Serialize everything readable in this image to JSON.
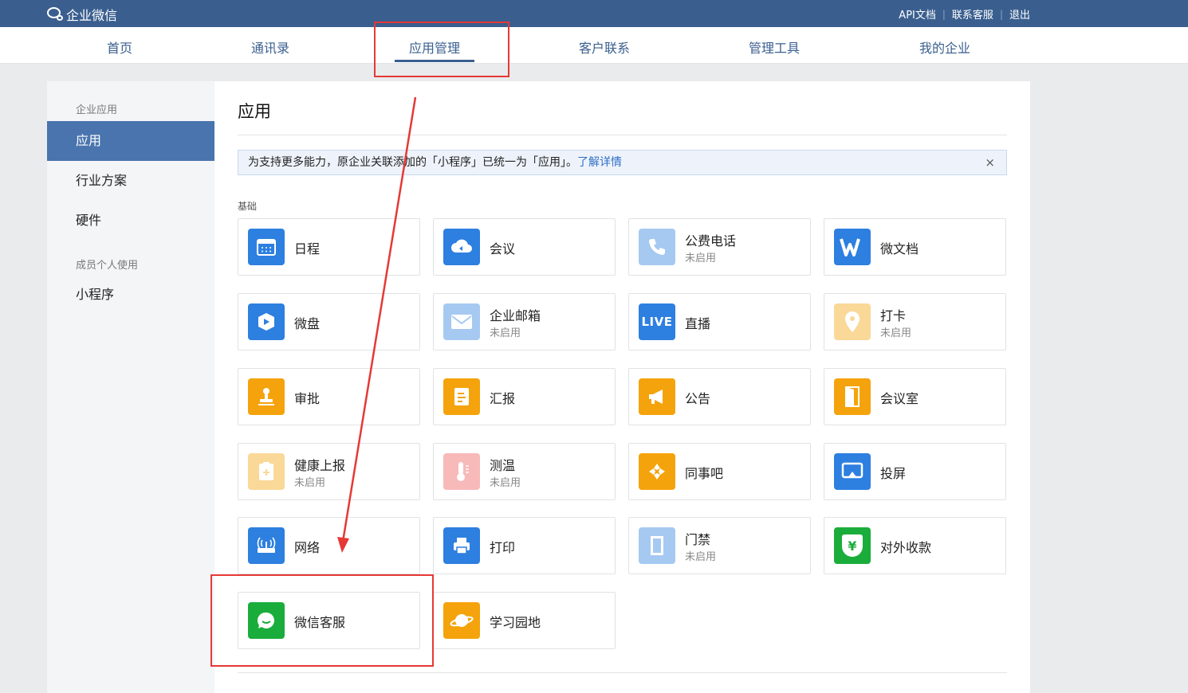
{
  "brand": {
    "name": "企业微信"
  },
  "top_links": [
    "API文档",
    "联系客服",
    "退出"
  ],
  "nav": {
    "items": [
      {
        "label": "首页"
      },
      {
        "label": "通讯录"
      },
      {
        "label": "应用管理",
        "active": true
      },
      {
        "label": "客户联系"
      },
      {
        "label": "管理工具"
      },
      {
        "label": "我的企业"
      }
    ]
  },
  "sidebar": {
    "groups": [
      {
        "title": "企业应用",
        "items": [
          {
            "label": "应用",
            "active": true
          },
          {
            "label": "行业方案"
          },
          {
            "label": "硬件"
          }
        ]
      },
      {
        "title": "成员个人使用",
        "items": [
          {
            "label": "小程序"
          }
        ]
      }
    ]
  },
  "main": {
    "title": "应用",
    "notice": {
      "text": "为支持更多能力，原企业关联添加的「小程序」已统一为「应用」。",
      "link": "了解详情",
      "close": "×"
    },
    "section": "基础",
    "apps": [
      {
        "name": "日程",
        "status": "",
        "icon": "calendar-icon",
        "color": "#2d7fe0"
      },
      {
        "name": "会议",
        "status": "",
        "icon": "cloud-meeting-icon",
        "color": "#2d7fe0"
      },
      {
        "name": "公费电话",
        "status": "未启用",
        "icon": "phone-icon",
        "color": "#2d7fe0"
      },
      {
        "name": "微文档",
        "status": "",
        "icon": "document-w-icon",
        "color": "#2d7fe0"
      },
      {
        "name": "微盘",
        "status": "",
        "icon": "drive-icon",
        "color": "#2d7fe0"
      },
      {
        "name": "企业邮箱",
        "status": "未启用",
        "icon": "mail-icon",
        "color": "#2d7fe0"
      },
      {
        "name": "直播",
        "status": "",
        "icon": "live-icon",
        "color": "#2d7fe0",
        "badge": "LIVE"
      },
      {
        "name": "打卡",
        "status": "未启用",
        "icon": "location-pin-icon",
        "color": "#f5a30c"
      },
      {
        "name": "审批",
        "status": "",
        "icon": "stamp-icon",
        "color": "#f5a30c"
      },
      {
        "name": "汇报",
        "status": "",
        "icon": "report-icon",
        "color": "#f5a30c"
      },
      {
        "name": "公告",
        "status": "",
        "icon": "megaphone-icon",
        "color": "#f5a30c"
      },
      {
        "name": "会议室",
        "status": "",
        "icon": "door-icon",
        "color": "#f5a30c"
      },
      {
        "name": "健康上报",
        "status": "未启用",
        "icon": "health-report-icon",
        "color": "#f5a30c"
      },
      {
        "name": "测温",
        "status": "未启用",
        "icon": "thermometer-icon",
        "color": "#f05b5b"
      },
      {
        "name": "同事吧",
        "status": "",
        "icon": "colleague-forum-icon",
        "color": "#f5a30c"
      },
      {
        "name": "投屏",
        "status": "",
        "icon": "screen-cast-icon",
        "color": "#2d7fe0"
      },
      {
        "name": "网络",
        "status": "",
        "icon": "router-icon",
        "color": "#2d7fe0"
      },
      {
        "name": "打印",
        "status": "",
        "icon": "printer-icon",
        "color": "#2d7fe0"
      },
      {
        "name": "门禁",
        "status": "未启用",
        "icon": "access-door-icon",
        "color": "#2d7fe0"
      },
      {
        "name": "对外收款",
        "status": "",
        "icon": "payment-yen-icon",
        "color": "#1aad3b",
        "badge": "¥"
      },
      {
        "name": "微信客服",
        "status": "",
        "icon": "wechat-service-icon",
        "color": "#1aad3b"
      },
      {
        "name": "学习园地",
        "status": "",
        "icon": "planet-icon",
        "color": "#f5a30c"
      }
    ]
  }
}
